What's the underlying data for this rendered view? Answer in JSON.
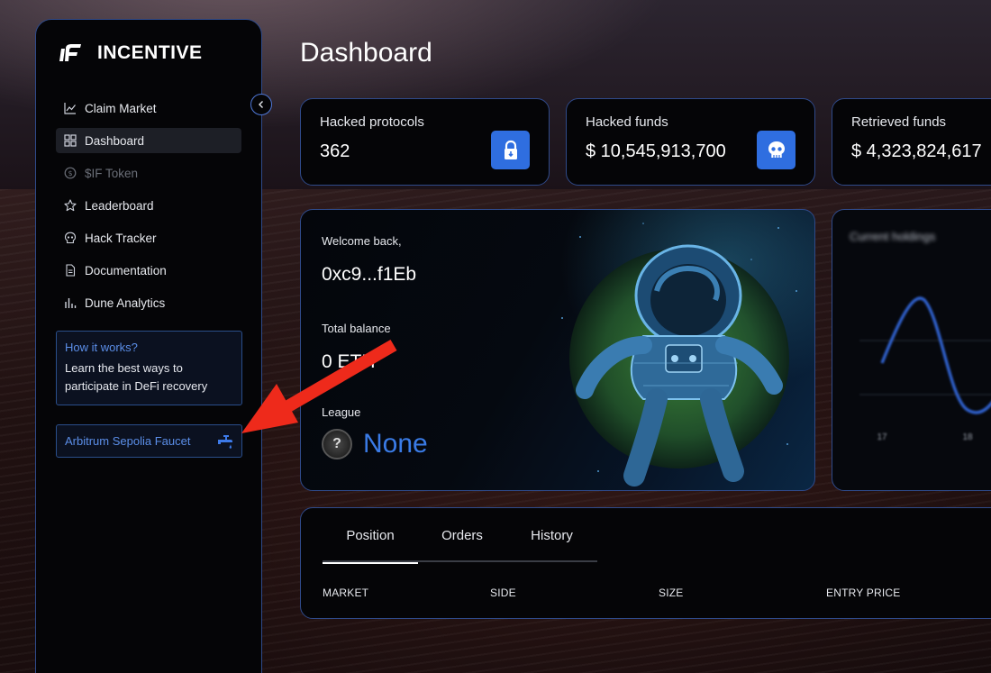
{
  "app": {
    "brand": "INCENTIVE"
  },
  "sidebar": {
    "items": [
      {
        "label": "Claim Market",
        "icon": "chart-line-icon",
        "active": false,
        "disabled": false
      },
      {
        "label": "Dashboard",
        "icon": "grid-icon",
        "active": true,
        "disabled": false
      },
      {
        "label": "$IF Token",
        "icon": "coin-icon",
        "active": false,
        "disabled": true
      },
      {
        "label": "Leaderboard",
        "icon": "star-icon",
        "active": false,
        "disabled": false
      },
      {
        "label": "Hack Tracker",
        "icon": "skull-icon",
        "active": false,
        "disabled": false
      },
      {
        "label": "Documentation",
        "icon": "document-icon",
        "active": false,
        "disabled": false
      },
      {
        "label": "Dune Analytics",
        "icon": "bar-chart-icon",
        "active": false,
        "disabled": false
      }
    ],
    "how_it_works": {
      "title": "How it works?",
      "line1": "Learn the best ways to",
      "line2": "participate in DeFi recovery"
    },
    "faucet_label": "Arbitrum Sepolia Faucet"
  },
  "page": {
    "title": "Dashboard"
  },
  "stats": [
    {
      "label": "Hacked protocols",
      "value": "362",
      "icon": "lock-icon"
    },
    {
      "label": "Hacked funds",
      "value": "$ 10,545,913,700",
      "icon": "skull-icon"
    },
    {
      "label": "Retrieved funds",
      "value": "$ 4,323,824,617"
    }
  ],
  "welcome": {
    "greeting": "Welcome back,",
    "address": "0xc9...f1Eb",
    "balance_label": "Total balance",
    "balance_value": "0 ETH",
    "league_label": "League",
    "league_badge": "?",
    "league_value": "None"
  },
  "holdings": {
    "title": "Current holdings",
    "tick_labels": [
      "17",
      "18"
    ]
  },
  "positions": {
    "tabs": [
      "Position",
      "Orders",
      "History"
    ],
    "active_tab": "Position",
    "columns": [
      "MARKET",
      "SIDE",
      "SIZE",
      "ENTRY PRICE"
    ]
  },
  "colors": {
    "accent": "#2f6ee0",
    "border": "#2f4a8a",
    "link": "#5b8ee8",
    "annotation_arrow": "#ee2a1b"
  }
}
